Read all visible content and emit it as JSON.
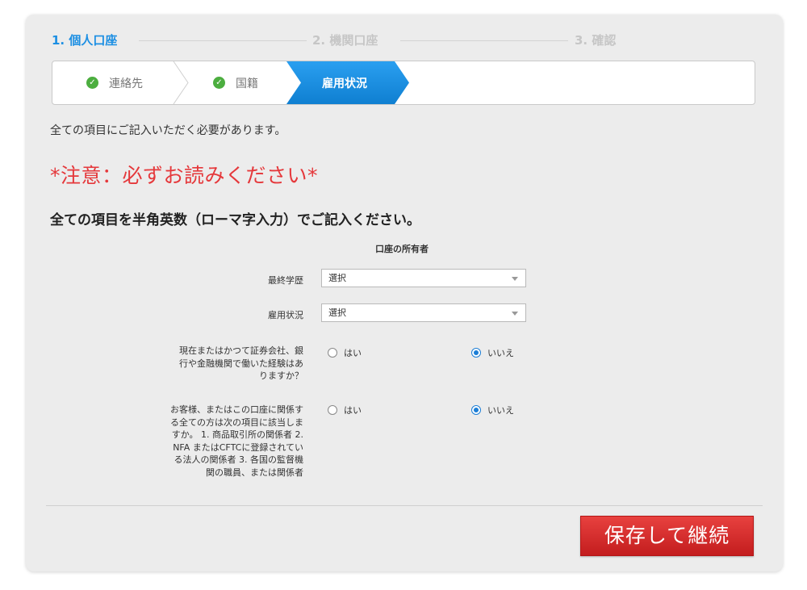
{
  "steps": [
    {
      "label": "1. 個人口座",
      "state": "active"
    },
    {
      "label": "2. 機関口座",
      "state": "inactive"
    },
    {
      "label": "3. 確認",
      "state": "inactive"
    }
  ],
  "breadcrumbs": {
    "done": [
      {
        "label": "連絡先",
        "icon": "check-circle-icon"
      },
      {
        "label": "国籍",
        "icon": "check-circle-icon"
      }
    ],
    "current": "雇用状況"
  },
  "intro": "全ての項目にご記入いただく必要があります。",
  "warning": "*注意：必ずお読みください*",
  "subhead": "全ての項目を半角英数（ローマ字入力）でご記入ください。",
  "form": {
    "column_header": "口座の所有者",
    "education": {
      "label": "最終学歴",
      "value": "選択"
    },
    "employment": {
      "label": "雇用状況",
      "value": "選択"
    },
    "q1": {
      "label": "現在またはかつて証券会社、銀行や金融機関で働いた経験はありますか？",
      "yes": "はい",
      "no": "いいえ",
      "selected": "no"
    },
    "q2": {
      "label": "お客様、またはこの口座に関係する全ての方は次の項目に該当しますか。 1. 商品取引所の関係者 2. NFA またはCFTCに登録されている法人の関係者 3. 各国の監督機関の職員、または関係者",
      "yes": "はい",
      "no": "いいえ",
      "selected": "no"
    }
  },
  "save_button": "保存して継続",
  "colors": {
    "accent_blue": "#1c8fe3",
    "check_green": "#4cae3f",
    "warning_red": "#e5383b",
    "button_red": "#d42b2b"
  }
}
